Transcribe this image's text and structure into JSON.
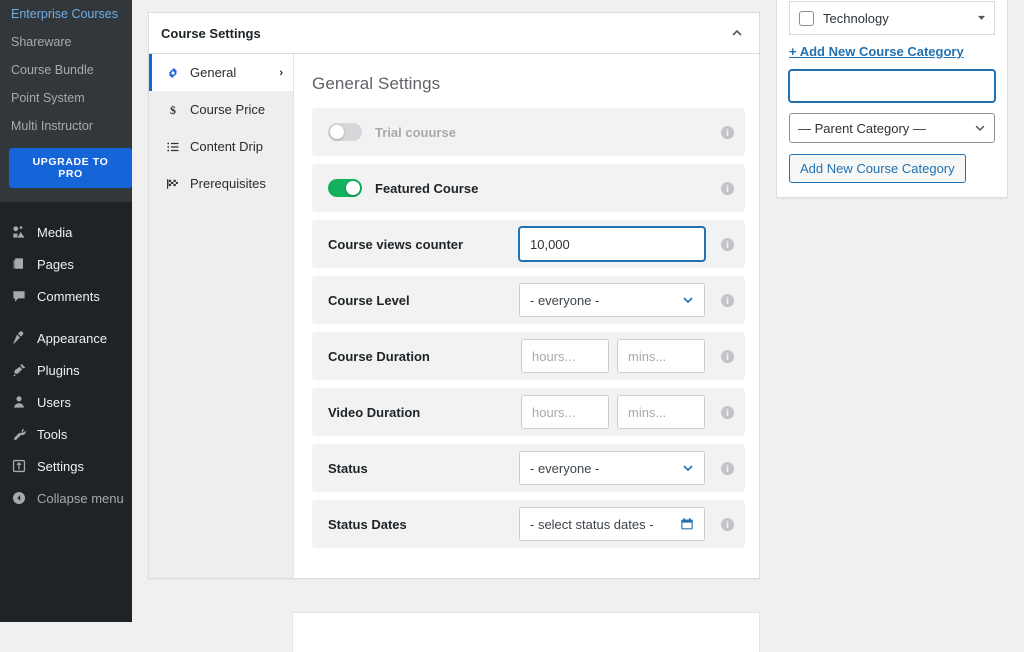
{
  "wp_sidebar": {
    "upper_items": [
      {
        "label": "Enterprise Courses",
        "icon": "none"
      },
      {
        "label": "Shareware",
        "icon": "none"
      },
      {
        "label": "Course Bundle",
        "icon": "none"
      },
      {
        "label": "Point System",
        "icon": "none"
      },
      {
        "label": "Multi Instructor",
        "icon": "none"
      }
    ],
    "upgrade_button": "UPGRADE TO PRO",
    "lower_items": [
      {
        "label": "Media",
        "icon": "media-icon"
      },
      {
        "label": "Pages",
        "icon": "pages-icon"
      },
      {
        "label": "Comments",
        "icon": "comments-icon"
      },
      {
        "label": "Appearance",
        "icon": "appearance-icon"
      },
      {
        "label": "Plugins",
        "icon": "plugins-icon"
      },
      {
        "label": "Users",
        "icon": "users-icon"
      },
      {
        "label": "Tools",
        "icon": "tools-icon"
      },
      {
        "label": "Settings",
        "icon": "settings-icon"
      },
      {
        "label": "Collapse menu",
        "icon": "collapse-icon"
      }
    ]
  },
  "course_settings": {
    "title": "Course Settings",
    "collapse_icon": "chevron-up-icon",
    "tabs": [
      {
        "label": "General",
        "icon": "gear-icon",
        "active": true,
        "arrow": "›"
      },
      {
        "label": "Course Price",
        "icon": "dollar-icon",
        "active": false
      },
      {
        "label": "Content Drip",
        "icon": "list-icon",
        "active": false
      },
      {
        "label": "Prerequisites",
        "icon": "flag-icon",
        "active": false
      }
    ],
    "panel_title": "General Settings",
    "fields": {
      "trial_course": {
        "label": "Trial couurse",
        "toggle": "off",
        "info": "info-icon"
      },
      "featured_course": {
        "label": "Featured Course",
        "toggle": "on",
        "info": "info-icon"
      },
      "course_views": {
        "label": "Course views counter",
        "value": "10,000",
        "focused": true,
        "info": "info-icon"
      },
      "course_level": {
        "label": "Course Level",
        "value": "- everyone -",
        "info": "info-icon"
      },
      "course_duration": {
        "label": "Course Duration",
        "hours_placeholder": "hours...",
        "mins_placeholder": "mins...",
        "hours_value": "",
        "mins_value": "",
        "info": "info-icon"
      },
      "video_duration": {
        "label": "Video Duration",
        "hours_placeholder": "hours...",
        "mins_placeholder": "mins...",
        "hours_value": "",
        "mins_value": "",
        "info": "info-icon"
      },
      "status": {
        "label": "Status",
        "value": "- everyone -",
        "info": "info-icon"
      },
      "status_dates": {
        "label": "Status Dates",
        "value": "- select status dates -",
        "icon": "calendar-icon",
        "info": "info-icon"
      }
    }
  },
  "course_category_box": {
    "category_item": "Technology",
    "category_caret": "caret-down-icon",
    "add_new_link": "+ Add New Course Category",
    "new_category_value": "",
    "new_category_placeholder": "",
    "parent_category": "— Parent Category —",
    "parent_caret": "chevron-down-icon",
    "submit_button": "Add New Course Category"
  },
  "colors": {
    "wp_sidebar_bg": "#1d2327",
    "wp_sidebar_upper_bg": "#32373c",
    "accent_blue": "#1565d8",
    "link_blue": "#2271b1",
    "toggle_green": "#13b05e",
    "field_bg": "#f2f2f2",
    "page_bg": "#f0f0f1"
  }
}
